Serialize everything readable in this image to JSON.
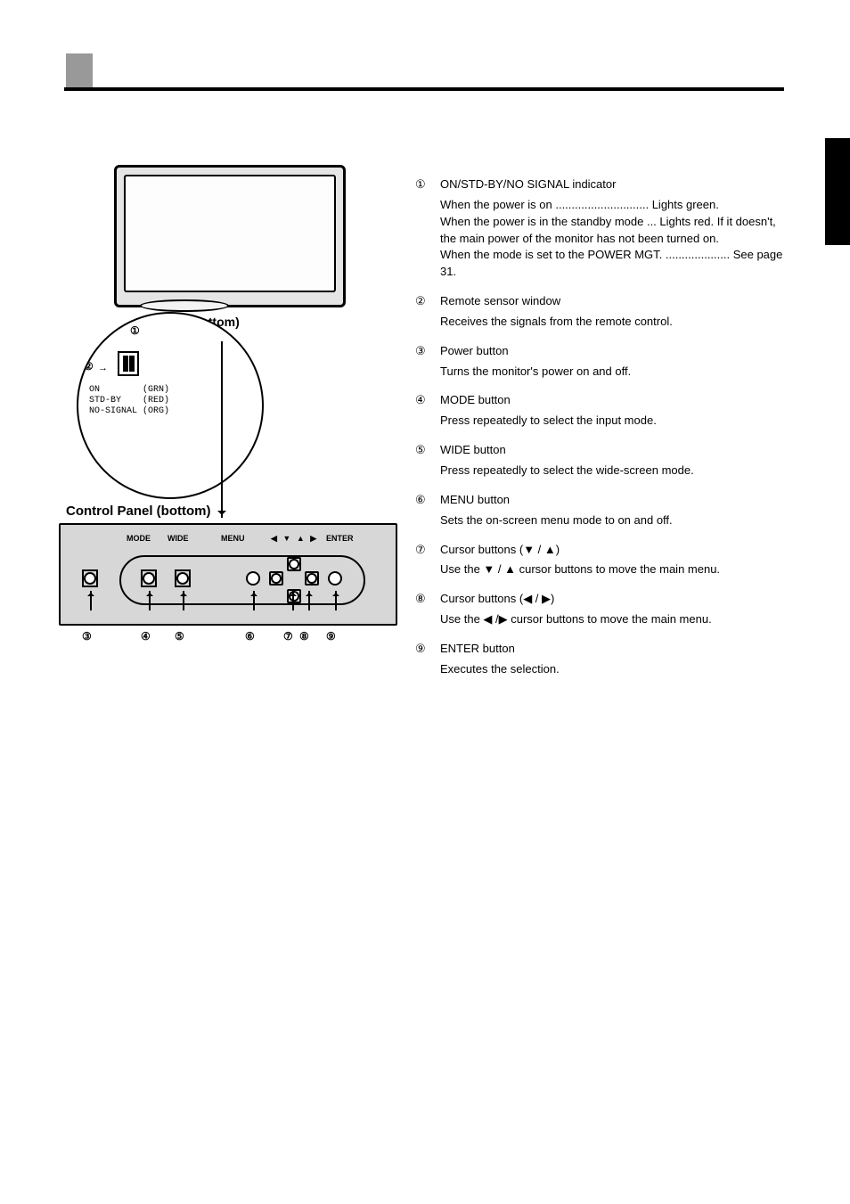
{
  "diagram": {
    "bottom_label": "(bottom)",
    "cp_title": "Control Panel (bottom)",
    "legend_lines": "ON        (GRN)\nSTD-BY    (RED)\nNO-SIGNAL (ORG)",
    "panel_labels": {
      "mode": "MODE",
      "wide": "WIDE",
      "menu": "MENU",
      "arrows": "◀ ▼ ▲ ▶",
      "enter": "ENTER"
    },
    "nums": {
      "n1": "①",
      "n2": "②",
      "n3": "③",
      "n4": "④",
      "n5": "⑤",
      "n6": "⑥",
      "n7": "⑦",
      "n8": "⑧",
      "n9": "⑨"
    }
  },
  "items": [
    {
      "num": "①",
      "title": "ON/STD-BY/NO SIGNAL indicator",
      "body": "When the power is on ............................. Lights green.\nWhen the power is in the standby mode ... Lights red. If it doesn't, the main power of the monitor has not been turned on.\nWhen the mode is set to the POWER MGT. .................... See page 31.",
      "extra": null
    },
    {
      "num": "②",
      "title": "Remote sensor window",
      "body": "Receives the signals from the remote control."
    },
    {
      "num": "③",
      "title": "Power button",
      "body": "Turns the monitor's power on and off."
    },
    {
      "num": "④",
      "title": "MODE button",
      "body": "Press repeatedly to select the input mode."
    },
    {
      "num": "⑤",
      "title": "WIDE button",
      "body": "Press repeatedly to select the wide-screen mode."
    },
    {
      "num": "⑥",
      "title": "MENU button",
      "body": "Sets the on-screen menu mode to on and off."
    },
    {
      "num": "⑦",
      "title": "Cursor buttons (▼ / ▲)",
      "body": "Use the ▼ / ▲ cursor buttons to move the main menu."
    },
    {
      "num": "⑧",
      "title": "Cursor buttons (◀ / ▶)",
      "body": "Use the ◀ /▶ cursor buttons to move the main menu."
    },
    {
      "num": "⑨",
      "title": "ENTER button",
      "body": "Executes the selection."
    }
  ]
}
